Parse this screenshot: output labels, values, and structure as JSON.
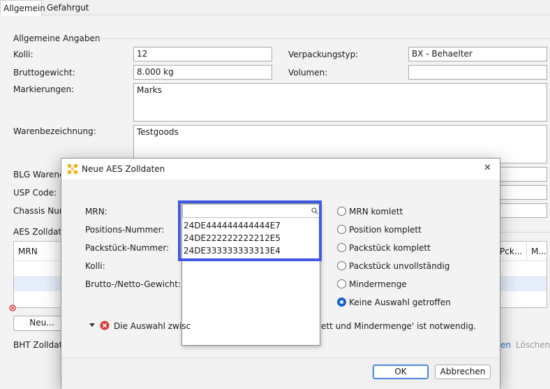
{
  "tabs": [
    {
      "label": "Allgemein",
      "active": true
    },
    {
      "label": "Gefahrgut",
      "active": false
    }
  ],
  "form": {
    "section_title": "Allgemeine Angaben",
    "kolli_label": "Kolli:",
    "kolli_value": "12",
    "verpackung_label": "Verpackungstyp:",
    "verpackung_value": "BX - Behaelter",
    "brutto_label": "Bruttogewicht:",
    "brutto_value": "8.000 kg",
    "volumen_label": "Volumen:",
    "volumen_value": "",
    "markierungen_label": "Markierungen:",
    "markierungen_value": "Marks",
    "waren_label": "Warenbezeichnung:",
    "waren_value": "Testgoods",
    "blg_label": "BLG Warenco",
    "usp_label": "USP Code:",
    "chassis_label": "Chassis Num",
    "aes_section": "AES Zolldate",
    "table_headers": [
      "MRN",
      "Pck...",
      "M..."
    ],
    "new_button": "Neu...",
    "bht_label": "BHT Zolldate",
    "link_partial": "en",
    "loeschen": "Löschen"
  },
  "dialog": {
    "title": "Neue AES Zolldaten",
    "close": "✕",
    "labels": {
      "mrn": "MRN:",
      "positions": "Positions-Nummer:",
      "packstueck": "Packstück-Nummer:",
      "kolli": "Kolli:",
      "gewicht": "Brutto-/Netto-Gewicht:"
    },
    "search_value": "",
    "dropdown_items": [
      "24DE444444444444E7",
      "24DE222222222212E5",
      "24DE333333333313E4"
    ],
    "radios": [
      {
        "label": "MRN komlett",
        "checked": false
      },
      {
        "label": "Position komplett",
        "checked": false
      },
      {
        "label": "Packstück komplett",
        "checked": false
      },
      {
        "label": "Packstück unvollständig",
        "checked": false
      },
      {
        "label": "Mindermenge",
        "checked": false
      },
      {
        "label": "Keine Auswahl getroffen",
        "checked": true
      }
    ],
    "error_left": "Die Auswahl zwisc",
    "error_right": "ett und Mindermenge' ist notwendig.",
    "ok_label": "OK",
    "cancel_label": "Abbrechen"
  },
  "colors": {
    "highlight": "#3f58e3",
    "error": "#d83b3b",
    "accent": "#1763c9"
  }
}
